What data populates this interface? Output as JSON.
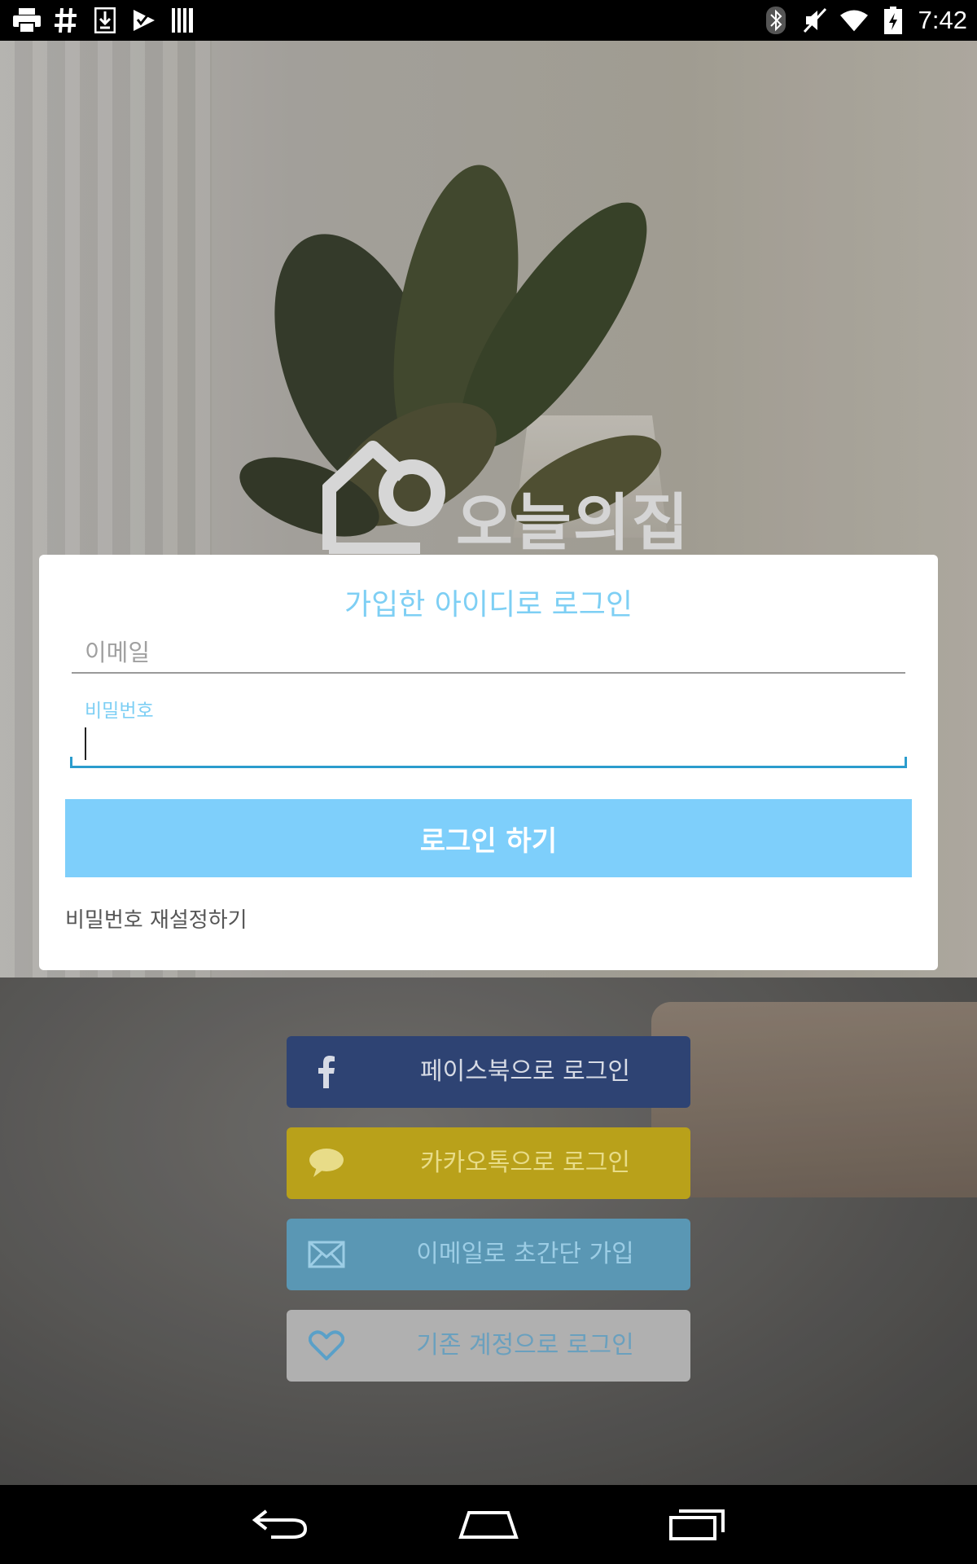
{
  "status_bar": {
    "time": "7:42",
    "left_icons": [
      "printer-icon",
      "hash-icon",
      "download-icon",
      "check-flag-icon",
      "barcode-icon"
    ],
    "right_icons": [
      "bluetooth-icon",
      "muted-icon",
      "wifi-icon",
      "battery-charging-icon"
    ]
  },
  "logo": {
    "text": "오늘의집"
  },
  "login_card": {
    "title": "가입한 아이디로 로그인",
    "email_placeholder": "이메일",
    "password_label": "비밀번호",
    "password_value": "",
    "login_button": "로그인 하기",
    "reset_link": "비밀번호 재설정하기"
  },
  "social_buttons": {
    "facebook": "페이스북으로 로그인",
    "kakao": "카카오톡으로 로그인",
    "email_signup": "이메일로 초간단 가입",
    "existing": "기존 계정으로 로그인"
  },
  "colors": {
    "accent": "#7ecffb",
    "facebook": "#2e4373",
    "kakao": "#b9a11a",
    "email": "#5a97b4",
    "existing": "#b0b0b0"
  },
  "nav_bar": {
    "icons": [
      "back-icon",
      "home-icon",
      "recents-icon"
    ]
  }
}
